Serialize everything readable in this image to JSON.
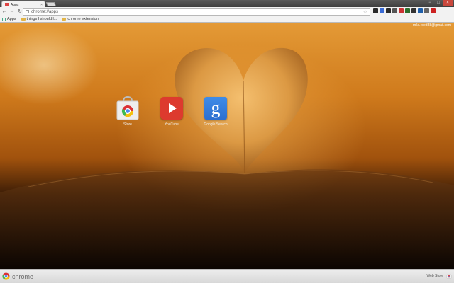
{
  "browser": {
    "tab_title": "Apps",
    "tab_close": "×",
    "window_controls": [
      "−",
      "□",
      "×"
    ],
    "nav": {
      "back": "←",
      "forward": "→",
      "reload": "↻"
    },
    "url": "chrome://apps",
    "star": "☆",
    "extension_colors": [
      "#2a2a2a",
      "#3a6bd6",
      "#2a2a2a",
      "#555",
      "#c33",
      "#2d6f2d",
      "#333",
      "#1f5faa",
      "#666",
      "#c22"
    ]
  },
  "bookmarks": [
    {
      "label": "Apps",
      "icon": "apps-grid-icon"
    },
    {
      "label": "things I should l...",
      "icon": "folder-icon"
    },
    {
      "label": "chrome extension",
      "icon": "folder-icon"
    }
  ],
  "user": {
    "email": "mila.reed88@gmail.com"
  },
  "apps": [
    {
      "label": "Store",
      "icon": "web-store-icon"
    },
    {
      "label": "YouTube",
      "icon": "youtube-icon"
    },
    {
      "label": "Google Search",
      "icon": "google-search-icon"
    }
  ],
  "footer": {
    "brand": "chrome",
    "webstore_label": "Web Store"
  },
  "colors": {
    "youtube": "#dd3a2e",
    "google": "#3f8ce8",
    "close": "#c9473c"
  }
}
